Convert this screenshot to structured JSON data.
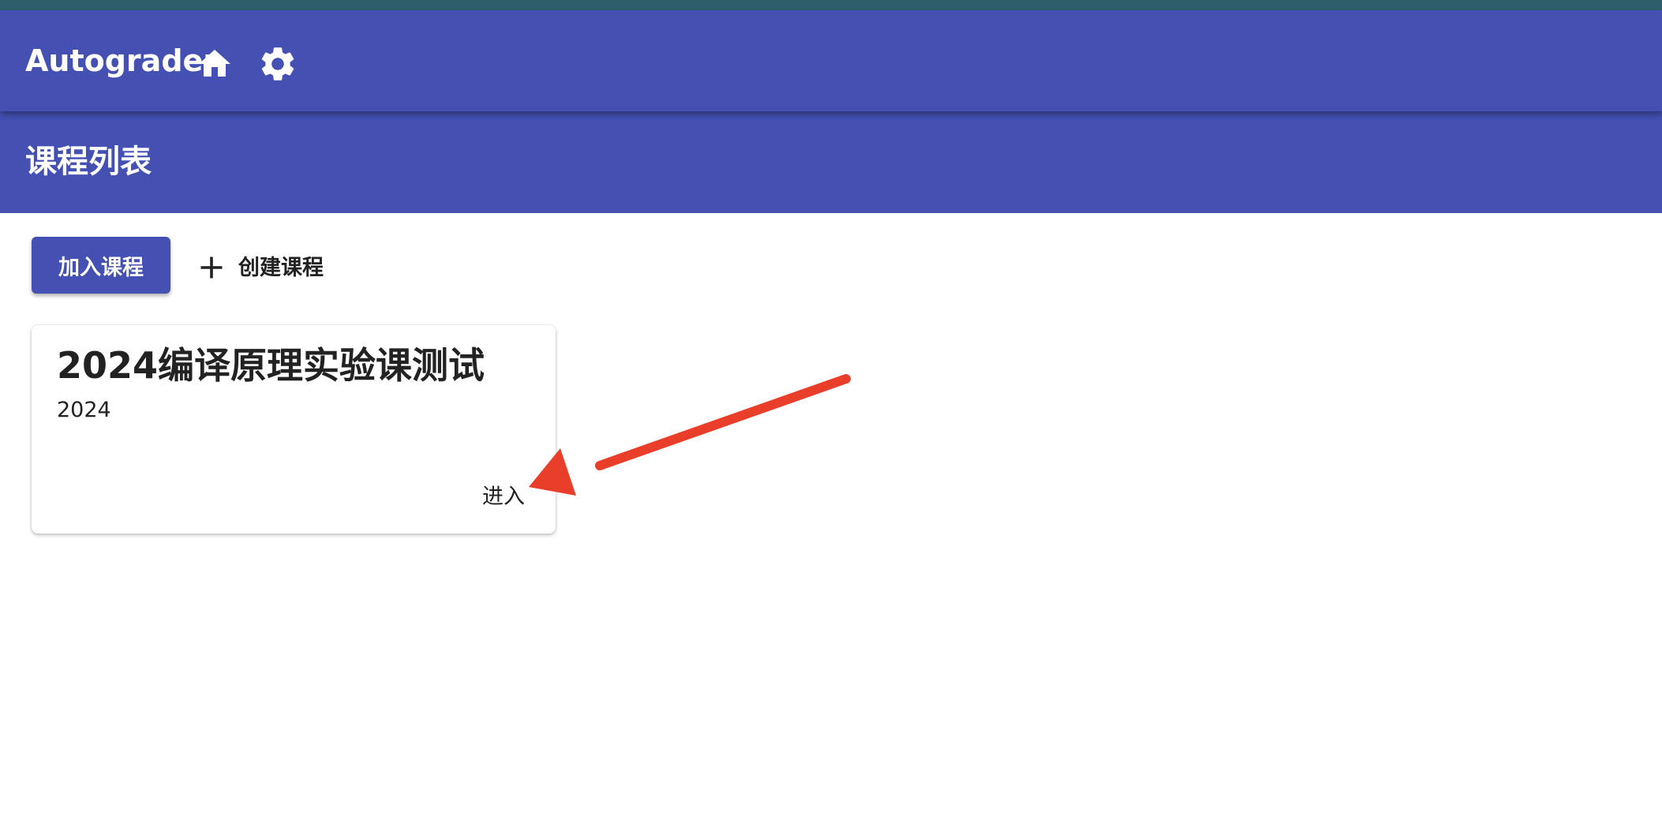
{
  "app_bar": {
    "title": "Autograder",
    "icons": [
      "home-icon",
      "gear-icon"
    ]
  },
  "sub_header": {
    "title": "课程列表"
  },
  "toolbar": {
    "join_label": "加入课程",
    "create_label": "创建课程",
    "create_icon": "plus-icon"
  },
  "courses": [
    {
      "title": "2024编译原理实验课测试",
      "year": "2024",
      "enter_label": "进入"
    }
  ],
  "colors": {
    "primary": "#4451b2",
    "top_strip": "#2f5e6b",
    "annotation_arrow": "#e83e2a",
    "text": "#222222"
  }
}
